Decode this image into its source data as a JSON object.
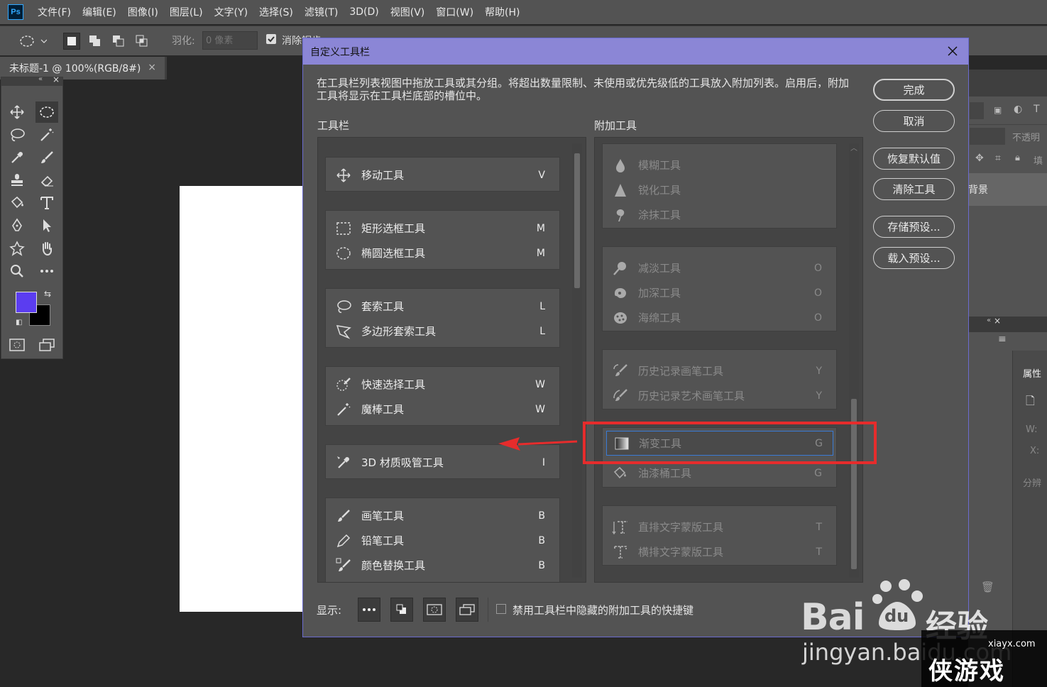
{
  "app": {
    "logo": "Ps"
  },
  "menu": [
    "文件(F)",
    "编辑(E)",
    "图像(I)",
    "图层(L)",
    "文字(Y)",
    "选择(S)",
    "滤镜(T)",
    "3D(D)",
    "视图(V)",
    "窗口(W)",
    "帮助(H)"
  ],
  "options": {
    "feather_label": "羽化:",
    "feather_placeholder": "0 像素",
    "antialias_label": "消除锯齿"
  },
  "document_tab": {
    "title": "未标题-1 @ 100%(RGB/8#)",
    "close": "×"
  },
  "colors": {
    "foreground": "#5b3df0",
    "background": "#000000",
    "dialog_title_bg": "#8b86d6",
    "highlight_border": "#e62c2c",
    "selected_border": "#3a7bd5"
  },
  "right_panel": {
    "opacity_label": "不透明",
    "fill_label": "填",
    "layer_label": "背景",
    "properties_title": "属性",
    "w_label": "W:",
    "x_label": "X:",
    "resolution_label": "分辨"
  },
  "dialog": {
    "title": "自定义工具栏",
    "description": "在工具栏列表视图中拖放工具或其分组。将超出数量限制、未使用或优先级低的工具放入附加列表。启用后，附加工具将显示在工具栏底部的槽位中。",
    "toolbar_title": "工具栏",
    "extra_title": "附加工具",
    "buttons": {
      "done": "完成",
      "cancel": "取消",
      "restore": "恢复默认值",
      "clear": "清除工具",
      "save": "存储预设...",
      "load": "载入预设..."
    },
    "show_label": "显示:",
    "disable_shortcuts_label": "禁用工具栏中隐藏的附加工具的快捷键",
    "toolbar_groups": [
      [
        {
          "name": "移动工具",
          "key": "V",
          "icon": "move-icon"
        }
      ],
      [
        {
          "name": "矩形选框工具",
          "key": "M",
          "icon": "rect-marquee-icon"
        },
        {
          "name": "椭圆选框工具",
          "key": "M",
          "icon": "ellipse-marquee-icon"
        }
      ],
      [
        {
          "name": "套索工具",
          "key": "L",
          "icon": "lasso-icon"
        },
        {
          "name": "多边形套索工具",
          "key": "L",
          "icon": "polygon-lasso-icon"
        }
      ],
      [
        {
          "name": "快速选择工具",
          "key": "W",
          "icon": "quick-select-icon"
        },
        {
          "name": "魔棒工具",
          "key": "W",
          "icon": "magic-wand-icon"
        }
      ],
      [
        {
          "name": "3D 材质吸管工具",
          "key": "I",
          "icon": "eyedropper-3d-icon"
        }
      ],
      [
        {
          "name": "画笔工具",
          "key": "B",
          "icon": "brush-icon"
        },
        {
          "name": "铅笔工具",
          "key": "B",
          "icon": "pencil-icon"
        },
        {
          "name": "颜色替换工具",
          "key": "B",
          "icon": "color-replace-icon"
        }
      ]
    ],
    "extra_groups": [
      [
        {
          "name": "模糊工具",
          "key": "",
          "icon": "blur-icon"
        },
        {
          "name": "锐化工具",
          "key": "",
          "icon": "sharpen-icon"
        },
        {
          "name": "涂抹工具",
          "key": "",
          "icon": "smudge-icon"
        }
      ],
      [
        {
          "name": "减淡工具",
          "key": "O",
          "icon": "dodge-icon"
        },
        {
          "name": "加深工具",
          "key": "O",
          "icon": "burn-icon"
        },
        {
          "name": "海绵工具",
          "key": "O",
          "icon": "sponge-icon"
        }
      ],
      [
        {
          "name": "历史记录画笔工具",
          "key": "Y",
          "icon": "history-brush-icon"
        },
        {
          "name": "历史记录艺术画笔工具",
          "key": "Y",
          "icon": "art-history-brush-icon"
        }
      ],
      [
        {
          "name": "渐变工具",
          "key": "G",
          "icon": "gradient-icon"
        },
        {
          "name": "油漆桶工具",
          "key": "G",
          "icon": "paint-bucket-icon"
        }
      ],
      [
        {
          "name": "直排文字蒙版工具",
          "key": "T",
          "icon": "vertical-type-mask-icon"
        },
        {
          "name": "横排文字蒙版工具",
          "key": "T",
          "icon": "horizontal-type-mask-icon"
        }
      ]
    ]
  },
  "watermark": {
    "brand": "Bai",
    "paw": "du",
    "suffix": "经验",
    "url": "jingyan.baidu.com",
    "site": "xiayx.com",
    "site_cn": "侠游戏"
  }
}
